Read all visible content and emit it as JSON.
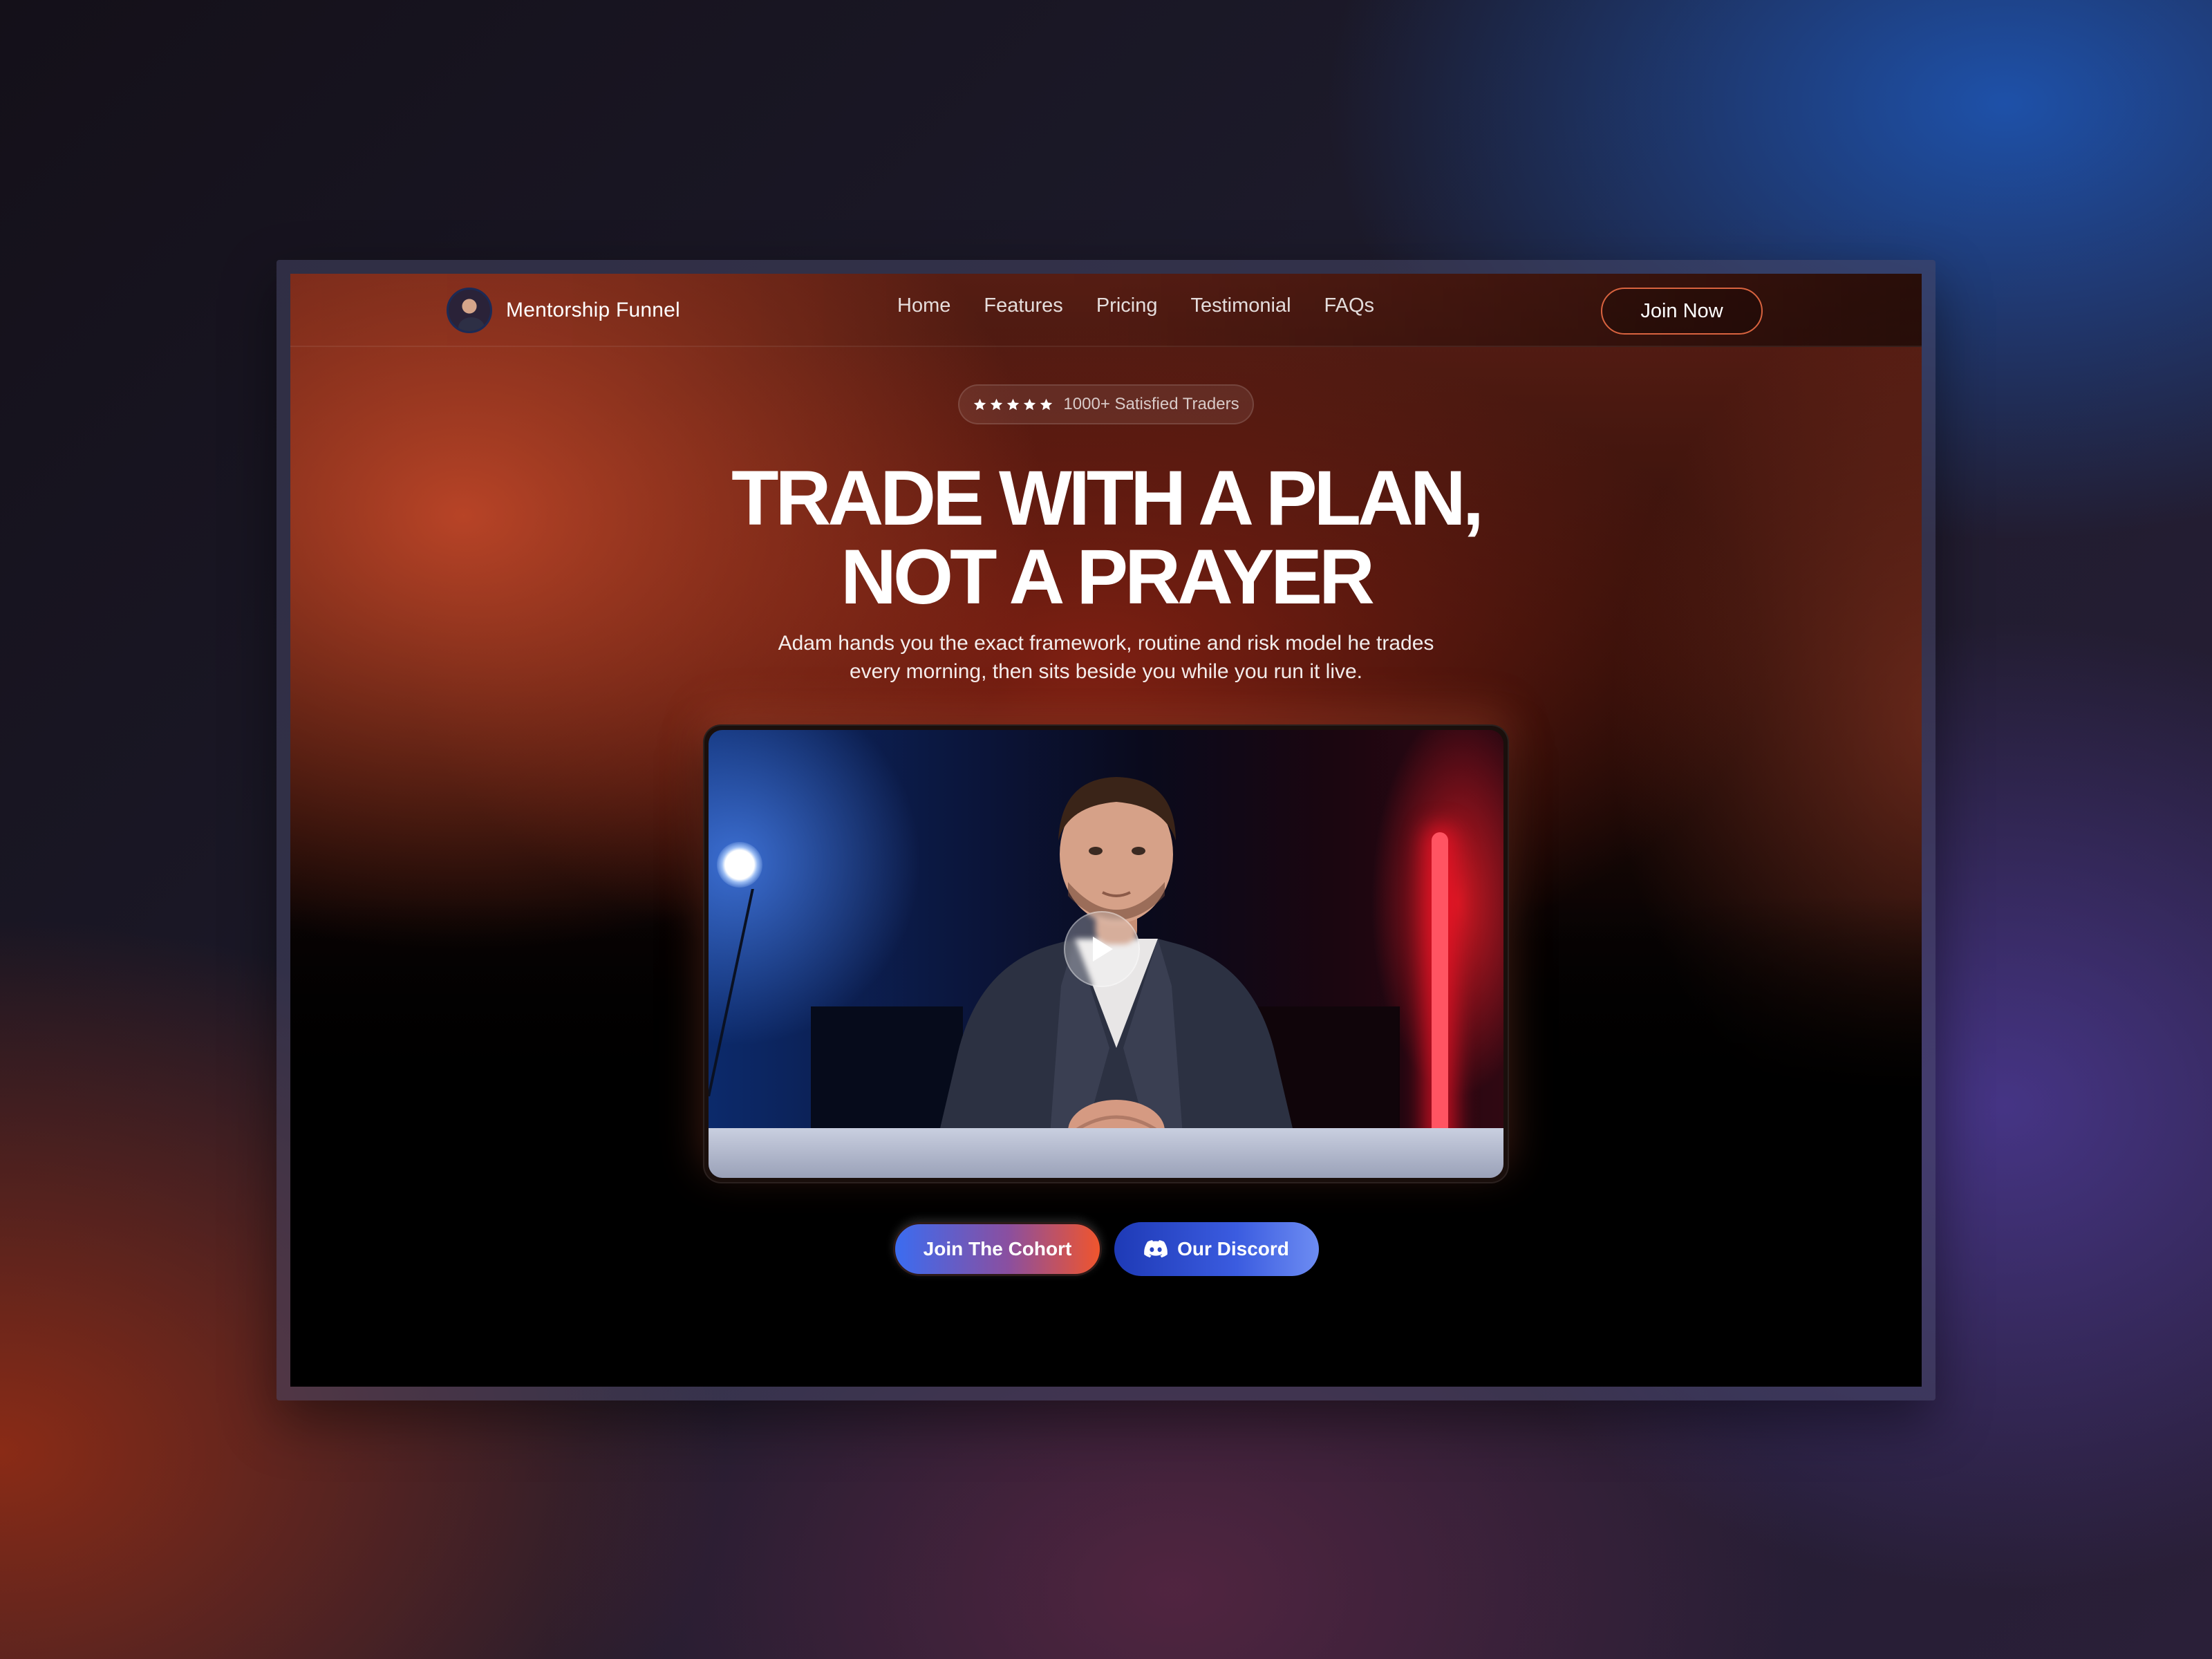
{
  "brand": {
    "name": "Mentorship Funnel"
  },
  "nav": {
    "links": [
      "Home",
      "Features",
      "Pricing",
      "Testimonial",
      "FAQs"
    ],
    "cta": "Join Now"
  },
  "hero": {
    "rating": {
      "stars": 5,
      "text": "1000+ Satisfied Traders"
    },
    "title_line1": "TRADE WITH A PLAN,",
    "title_line2": "NOT A PRAYER",
    "subtitle": "Adam hands you the exact framework, routine and risk model he trades every morning, then sits beside you while you run it live."
  },
  "video": {
    "play_icon": "play-icon"
  },
  "ctas": {
    "primary": "Join The Cohort",
    "secondary": "Our Discord",
    "secondary_icon": "discord-icon"
  },
  "colors": {
    "accent_orange": "#d9633f",
    "accent_blue": "#3b6cf0",
    "background": "#000000"
  }
}
